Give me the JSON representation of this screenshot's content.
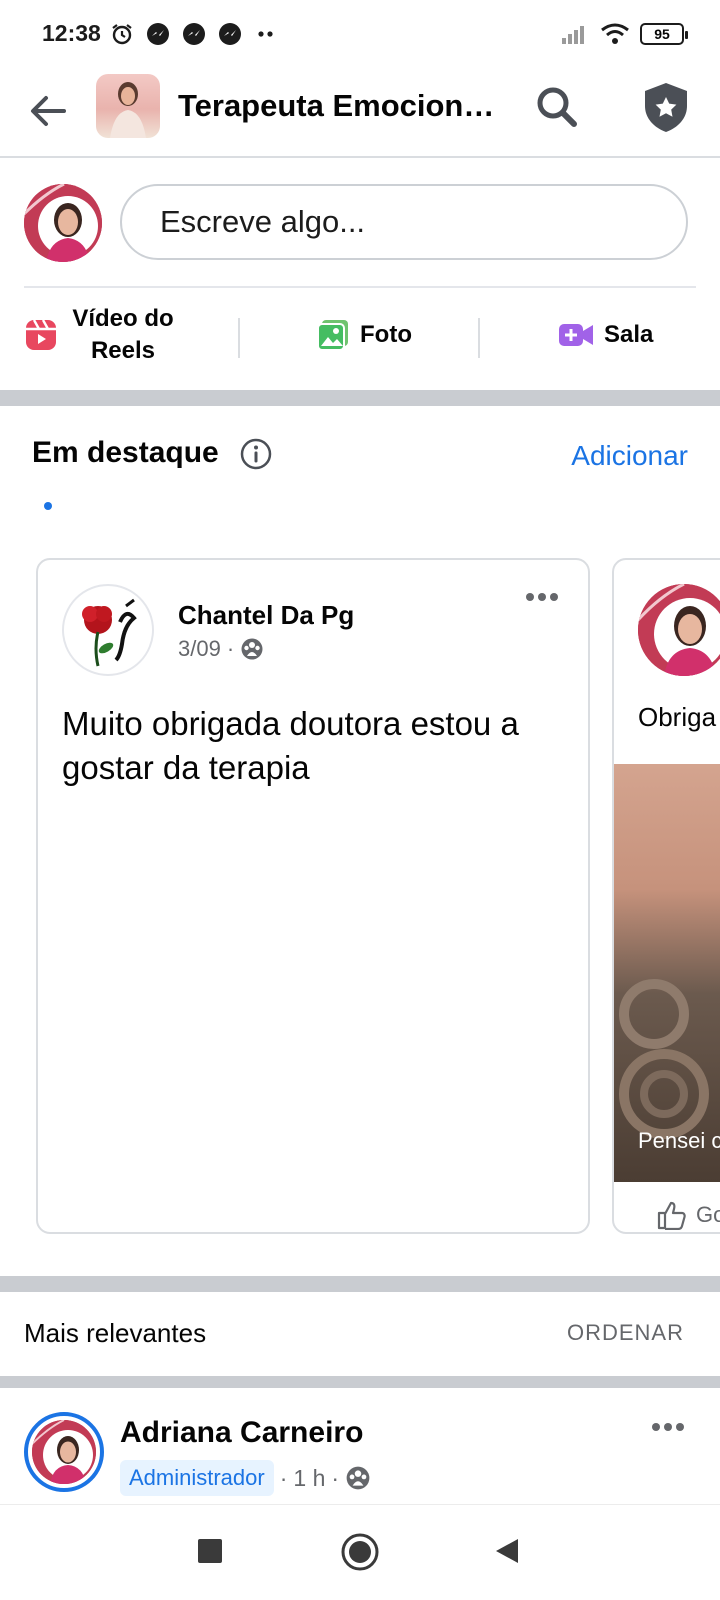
{
  "status_bar": {
    "time": "12:38",
    "battery": "95",
    "left_icons": [
      "alarm-icon",
      "messenger-icon",
      "messenger-icon",
      "messenger-icon",
      "more-dots-icon"
    ],
    "right_icons": [
      "signal-icon",
      "wifi-icon",
      "battery-icon"
    ]
  },
  "header": {
    "title": "Terapeuta Emocion…",
    "icons": [
      "back-arrow-icon",
      "search-icon",
      "shield-star-icon"
    ]
  },
  "composer": {
    "placeholder": "Escreve algo...",
    "actions": [
      {
        "label_line1": "Vídeo do",
        "label_line2": "Reels",
        "icon": "reels-icon"
      },
      {
        "label": "Foto",
        "icon": "photo-icon"
      },
      {
        "label": "Sala",
        "icon": "room-video-icon"
      }
    ]
  },
  "featured": {
    "title": "Em destaque",
    "add_label": "Adicionar",
    "cards": [
      {
        "author": "Chantel Da Pg",
        "date": "3/09",
        "text": "Muito obrigada doutora estou a gostar da terapia"
      },
      {
        "text": "Obriga",
        "caption": "Pensei c",
        "like_label": "Go"
      }
    ]
  },
  "sort": {
    "label": "Mais relevantes",
    "button": "ORDENAR"
  },
  "post": {
    "author": "Adriana Carneiro",
    "badge": "Administrador",
    "time": "1 h"
  },
  "colors": {
    "accent": "#1b74e4",
    "text": "#050505",
    "secondary_text": "#65676b",
    "separator": "#c9ccd1"
  }
}
